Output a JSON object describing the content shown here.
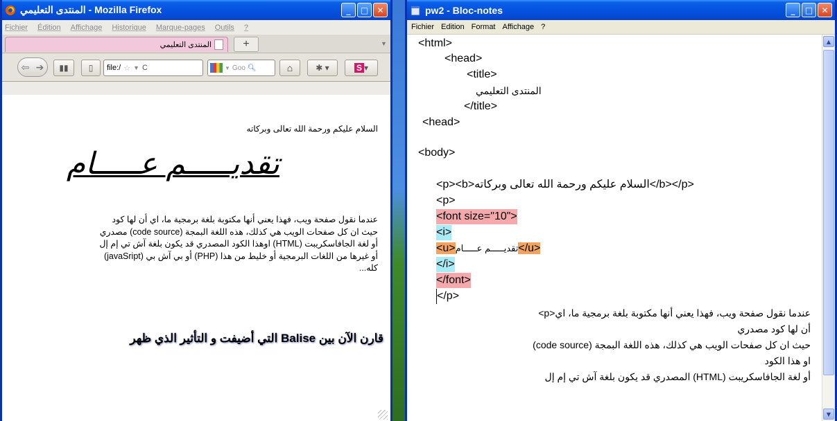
{
  "firefox": {
    "title": "المنتدى التعليمي - Mozilla Firefox",
    "menu": [
      "Fichier",
      "Édition",
      "Affichage",
      "Historique",
      "Marque-pages",
      "Outils",
      "?"
    ],
    "tab_label": "المنتدى التعليمي",
    "new_tab": "+",
    "url": "file:/",
    "search_placeholder": "Goo",
    "content": {
      "greeting": "السلام عليكم ورحمة الله تعالى وبركاته",
      "heading": "تقديـــــم عـــــام",
      "paragraph": [
        "عندما نقول صفحة ويب، فهذا يعني أنها مكتوبة بلغة برمجية ما، اي أن لها كود",
        "حيث ان كل صفحات الويب هي كذلك، هذه اللغة البمجة (code source) مصدري",
        "أو لغة الجافاسكريبت (HTML) اوهذا الكود المصدري قد يكون بلغة آش تي إم إل",
        "أو غيرها من اللغات البرمجية أو خليط من هذا (PHP) أو بي آش بي (javaSript)",
        "كله..."
      ],
      "compare_text": "قارن الآن بين Balise التي أضيفت و التأثير الذي ظهر"
    }
  },
  "notepad": {
    "title": "pw2 - Bloc-notes",
    "menu": [
      "Fichier",
      "Edition",
      "Format",
      "Affichage",
      "?"
    ],
    "lines": {
      "l1": "<html>",
      "l2": "<head>",
      "l3": "<title>",
      "l4": "المنتدى التعليمي",
      "l5": "</title>",
      "l6": "<head>",
      "l7": "<body>",
      "l8": "<p><b>السلام عليكم ورحمة الله تعالى وبركاته</b></p>",
      "l9": "<p>",
      "l10": "<font size=\"10\">",
      "l11": "<i>",
      "l12_open": "<u>",
      "l12_text": "تقديـــــم عـــــام",
      "l12_close": "</u>",
      "l13": "</i>",
      "l14": "</font>",
      "l15": "</p>",
      "l16": "عندما نقول صفحة ويب، فهذا يعني أنها مكتوبة بلغة برمجية ما، اي<p>",
      "l17": "أن لها كود مصدري",
      "l18": "حيث ان كل صفحات الويب هي كذلك، هذه اللغة البمجة (code source)",
      "l19": "او هذا الكود",
      "l20": "أو لغة الجافاسكريبت (HTML) المصدري قد يكون بلغة آش تي إم إل"
    }
  },
  "icons": {
    "firefox": "firefox-logo-icon",
    "notepad": "notepad-icon",
    "minimize": "minimize-icon",
    "maximize": "maximize-icon",
    "close": "close-icon"
  }
}
